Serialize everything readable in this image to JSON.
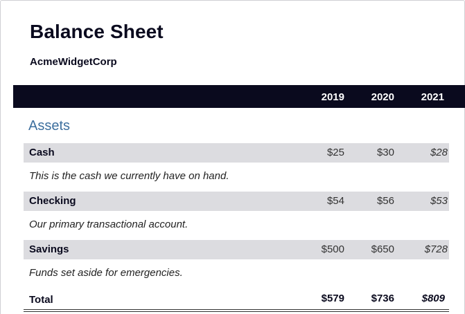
{
  "title": "Balance Sheet",
  "company": "AcmeWidgetCorp",
  "years": [
    "2019",
    "2020",
    "2021"
  ],
  "section": "Assets",
  "rows": [
    {
      "label": "Cash",
      "values": [
        "$25",
        "$30",
        "$28"
      ],
      "description": "This is the cash we currently have on hand."
    },
    {
      "label": "Checking",
      "values": [
        "$54",
        "$56",
        "$53"
      ],
      "description": "Our primary transactional account."
    },
    {
      "label": "Savings",
      "values": [
        "$500",
        "$650",
        "$728"
      ],
      "description": "Funds set aside for emergencies."
    }
  ],
  "total": {
    "label": "Total",
    "values": [
      "$579",
      "$736",
      "$809"
    ]
  },
  "colors": {
    "header_bg": "#0a0a1e",
    "row_bg": "#dcdce0",
    "section_title": "#3d6f9e"
  }
}
